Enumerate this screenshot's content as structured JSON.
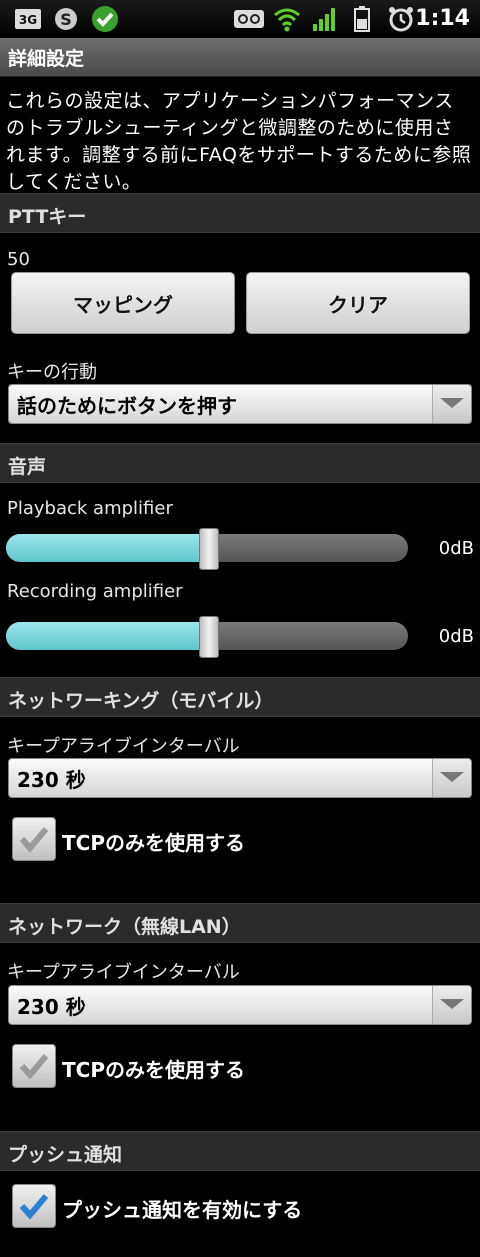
{
  "status": {
    "network_badge": "3G",
    "time": "1:14",
    "icons": [
      "3g-icon",
      "skype-icon",
      "check-circle-icon",
      "voicemail-icon",
      "wifi-icon",
      "signal-icon",
      "battery-icon",
      "alarm-icon"
    ]
  },
  "title": "詳細設定",
  "description": "これらの設定は、アプリケーションパフォーマンスのトラブルシューティングと微調整のために使用されます。調整する前にFAQをサポートするために参照してください。",
  "ptt": {
    "header": "PTTキー",
    "value": "50",
    "mapping_label": "マッピング",
    "clear_label": "クリア",
    "action_label": "キーの行動",
    "action_value": "話のためにボタンを押す"
  },
  "audio": {
    "header": "音声",
    "playback_label": "Playback amplifier",
    "playback_value": "0dB",
    "playback_level": 0.5,
    "recording_label": "Recording amplifier",
    "recording_value": "0dB",
    "recording_level": 0.5
  },
  "mobile": {
    "header": "ネットワーキング（モバイル）",
    "keepalive_label": "キープアライブインターバル",
    "keepalive_value": "230 秒",
    "tcp_label": "TCPのみを使用する",
    "tcp_checked": false
  },
  "wifi": {
    "header": "ネットワーク（無線LAN）",
    "keepalive_label": "キープアライブインターバル",
    "keepalive_value": "230 秒",
    "tcp_label": "TCPのみを使用する",
    "tcp_checked": false
  },
  "push": {
    "header": "プッシュ通知",
    "enable_label": "プッシュ通知を有効にする",
    "enable_checked": true
  },
  "colors": {
    "slider_fill": "#5cc6cc",
    "check_blue": "#2a7fd6",
    "check_grey": "#9a9a9a"
  }
}
